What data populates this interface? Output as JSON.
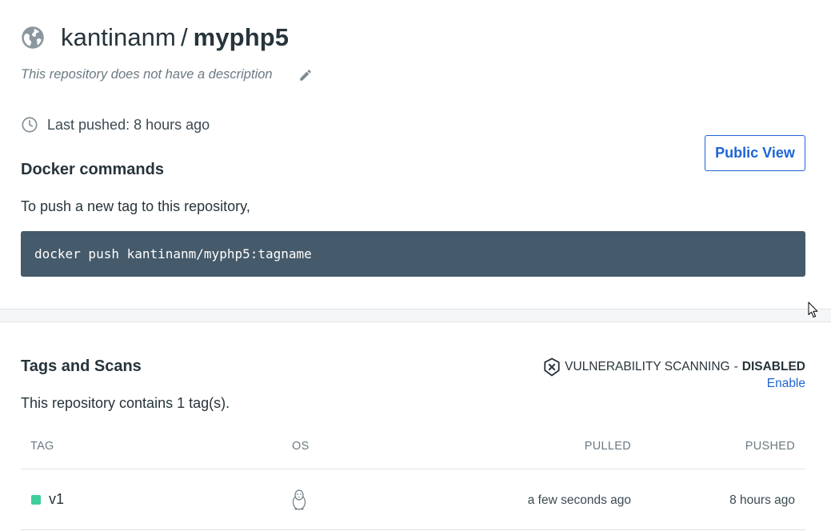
{
  "repo": {
    "namespace": "kantinanm",
    "separator": "/",
    "name": "myphp5",
    "visibility_icon": "globe-icon",
    "description": "This repository does not have a description",
    "last_pushed": "Last pushed: 8 hours ago"
  },
  "actions": {
    "public_view_label": "Public View"
  },
  "docker_commands": {
    "heading": "Docker commands",
    "hint": "To push a new tag to this repository,",
    "command": "docker push kantinanm/myphp5:tagname"
  },
  "tags_section": {
    "heading": "Tags and Scans",
    "count_text": "This repository contains 1 tag(s).",
    "vuln_label": "VULNERABILITY SCANNING",
    "vuln_separator": "-",
    "vuln_status": "DISABLED",
    "enable_label": "Enable",
    "columns": {
      "tag": "TAG",
      "os": "OS",
      "pulled": "PULLED",
      "pushed": "PUSHED"
    },
    "rows": [
      {
        "tag": "v1",
        "os_icon": "linux-icon",
        "pulled": "a few seconds ago",
        "pushed": "8 hours ago"
      }
    ]
  },
  "colors": {
    "accent": "#1d63d6",
    "command_bg": "#455a6a",
    "tag_status": "#3fcf9c",
    "text": "#27343b"
  }
}
